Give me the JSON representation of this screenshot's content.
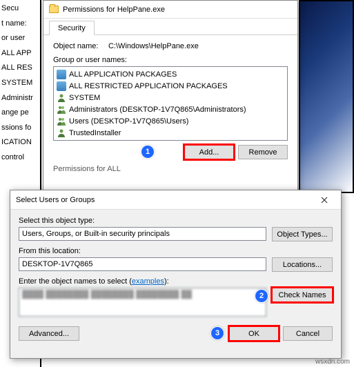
{
  "bg": {
    "l1": "Secu",
    "l2": "t name:",
    "l3": "or user",
    "l4": "ALL APP",
    "l5": "ALL RES",
    "l6": "SYSTEM",
    "l7": "Administr",
    "l8": "",
    "l9": "ange pe",
    "l10": "ssions fo",
    "l11": "ICATION",
    "l12": "control"
  },
  "win1": {
    "title": "Permissions for HelpPane.exe",
    "tab": "Security",
    "object_label": "Object name:",
    "object_value": "C:\\Windows\\HelpPane.exe",
    "group_label": "Group or user names:",
    "items": [
      "ALL APPLICATION PACKAGES",
      "ALL RESTRICTED APPLICATION PACKAGES",
      "SYSTEM",
      "Administrators (DESKTOP-1V7Q865\\Administrators)",
      "Users (DESKTOP-1V7Q865\\Users)",
      "TrustedInstaller"
    ],
    "add": "Add...",
    "remove": "Remove",
    "perm_for": "Permissions for ALL"
  },
  "win2": {
    "title": "Select Users or Groups",
    "obj_type_label": "Select this object type:",
    "obj_type_value": "Users, Groups, or Built-in security principals",
    "obj_types_btn": "Object Types...",
    "loc_label": "From this location:",
    "loc_value": "DESKTOP-1V7Q865",
    "loc_btn": "Locations...",
    "enter_label_a": "Enter the object names to select (",
    "enter_label_link": "examples",
    "enter_label_b": "):",
    "textarea_value": "████ ████████ ████████ ████████ ██",
    "check_names": "Check Names",
    "advanced": "Advanced...",
    "ok": "OK",
    "cancel": "Cancel"
  },
  "callouts": {
    "c1": "1",
    "c2": "2",
    "c3": "3"
  },
  "watermark": "wsxdn.com"
}
